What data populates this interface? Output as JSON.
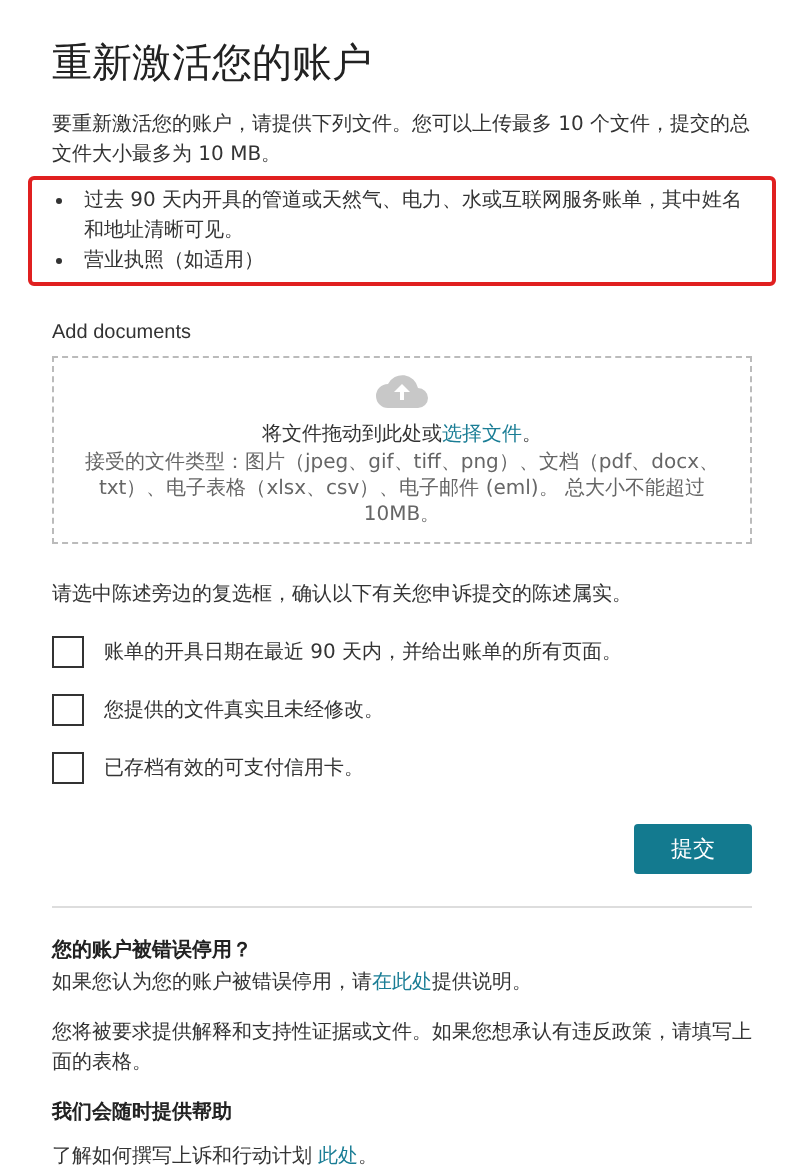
{
  "title": "重新激活您的账户",
  "intro": "要重新激活您的账户，请提供下列文件。您可以上传最多 10 个文件，提交的总文件大小最多为 10 MB。",
  "requirements": [
    "过去 90 天内开具的管道或天然气、电力、水或互联网服务账单，其中姓名和地址清晰可见。",
    "营业执照（如适用）"
  ],
  "upload": {
    "label": "Add documents",
    "drop_text": "将文件拖动到此处或",
    "drop_link": "选择文件",
    "drop_end": "。",
    "types": "接受的文件类型：图片（jpeg、gif、tiff、png）、文档（pdf、docx、txt）、电子表格（xlsx、csv）、电子邮件 (eml)。 总大小不能超过 10MB。"
  },
  "confirm_prompt": "请选中陈述旁边的复选框，确认以下有关您申诉提交的陈述属实。",
  "statements": [
    {
      "label": "账单的开具日期在最近 90 天内，并给出账单的所有页面。",
      "checked": false
    },
    {
      "label": "您提供的文件真实且未经修改。",
      "checked": false
    },
    {
      "label": "已存档有效的可支付信用卡。",
      "checked": false
    }
  ],
  "submit": "提交",
  "wrong_heading": "您的账户被错误停用？",
  "wrong_text": {
    "before": "如果您认为您的账户被错误停用，请",
    "link": "在此处",
    "after": "提供说明。"
  },
  "explain": "您将被要求提供解释和支持性证据或文件。如果您想承认有违反政策，请填写上面的表格。",
  "help_heading": "我们会随时提供帮助",
  "help_text": {
    "before": "了解如何撰写上诉和行动计划 ",
    "link": "此处",
    "after": "。"
  }
}
